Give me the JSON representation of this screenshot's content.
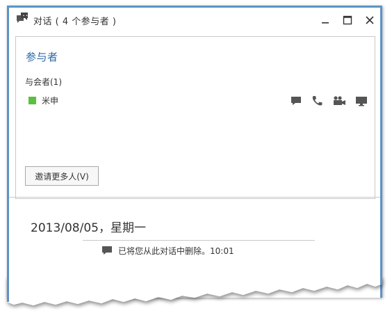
{
  "window": {
    "title": "对话 ( 4 个参与者 )",
    "accent_color": "#5c93c7",
    "title_icon": "conversation-icon",
    "controls": [
      "minimize-icon",
      "maximize-icon",
      "close-icon"
    ]
  },
  "participants": {
    "section_title": "参与者",
    "attendees_label": "与会者(1)",
    "items": [
      {
        "name": "米申",
        "presence_color": "#5cbf3f"
      }
    ],
    "actions": [
      "chat-icon",
      "phone-icon",
      "video-icon",
      "screen-share-icon"
    ],
    "invite_label": "邀请更多人(V)"
  },
  "conversation": {
    "date": "2013/08/05，星期一",
    "messages": [
      {
        "icon": "chat-icon",
        "text": "已将您从此对话中删除。10:01"
      }
    ]
  }
}
